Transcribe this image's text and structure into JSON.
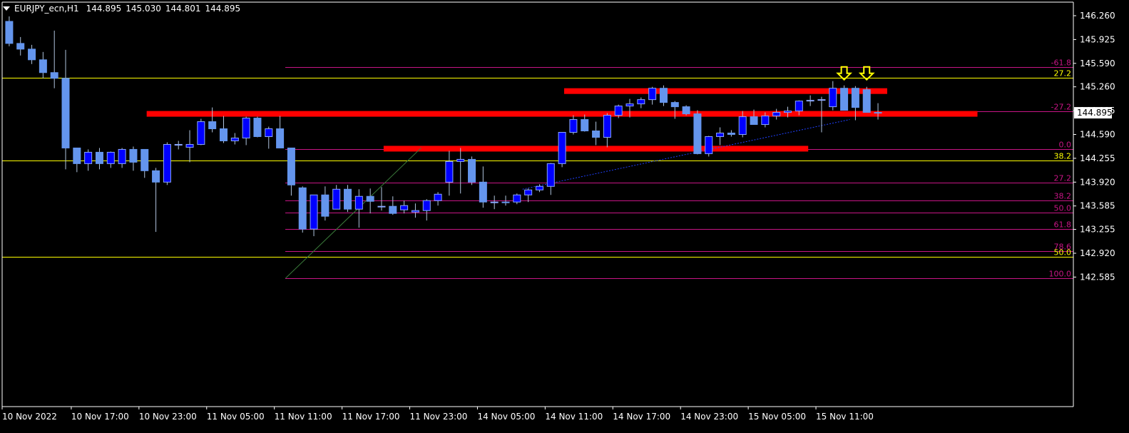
{
  "header": {
    "symbol": "EURJPY_ecn,H1",
    "open": "144.895",
    "high": "145.030",
    "low": "144.801",
    "close": "144.895"
  },
  "colors": {
    "background": "#000000",
    "axis": "#ffffff",
    "bull_candle": "#0000ff",
    "bear_candle": "#6495ed",
    "wick": "#b0c4de",
    "fib_ext_line": "#c71585",
    "fib_ext_label": "#c71585",
    "yellow_level": "#ffff00",
    "red_zone": "#ff0000",
    "trendline": "#2040ff",
    "arrows": "#ffff00",
    "price_label_bg": "#ffffff",
    "price_label_text": "#000000"
  },
  "chart_data": {
    "type": "candlestick",
    "timeframe": "H1",
    "y_ticks": [
      "146.260",
      "145.925",
      "145.590",
      "145.260",
      "144.925",
      "144.590",
      "144.255",
      "143.920",
      "143.585",
      "143.255",
      "142.920",
      "142.585"
    ],
    "x_ticks": [
      "10 Nov 2022",
      "10 Nov 17:00",
      "10 Nov 23:00",
      "11 Nov 05:00",
      "11 Nov 11:00",
      "11 Nov 17:00",
      "11 Nov 23:00",
      "14 Nov 05:00",
      "14 Nov 11:00",
      "14 Nov 17:00",
      "14 Nov 23:00",
      "15 Nov 05:00",
      "15 Nov 11:00"
    ],
    "current_price": "144.895",
    "candles": [
      {
        "o": 146.18,
        "h": 146.25,
        "l": 145.83,
        "c": 145.87
      },
      {
        "o": 145.87,
        "h": 145.96,
        "l": 145.7,
        "c": 145.79
      },
      {
        "o": 145.79,
        "h": 145.85,
        "l": 145.58,
        "c": 145.64
      },
      {
        "o": 145.64,
        "h": 145.75,
        "l": 145.38,
        "c": 145.46
      },
      {
        "o": 145.46,
        "h": 146.05,
        "l": 145.24,
        "c": 145.38
      },
      {
        "o": 145.38,
        "h": 145.78,
        "l": 144.1,
        "c": 144.4
      },
      {
        "o": 144.4,
        "h": 144.4,
        "l": 144.06,
        "c": 144.18
      },
      {
        "o": 144.18,
        "h": 144.38,
        "l": 144.08,
        "c": 144.34
      },
      {
        "o": 144.34,
        "h": 144.4,
        "l": 144.1,
        "c": 144.18
      },
      {
        "o": 144.18,
        "h": 144.35,
        "l": 144.12,
        "c": 144.34
      },
      {
        "o": 144.18,
        "h": 144.4,
        "l": 144.12,
        "c": 144.38
      },
      {
        "o": 144.38,
        "h": 144.42,
        "l": 144.08,
        "c": 144.2
      },
      {
        "o": 144.38,
        "h": 144.38,
        "l": 143.98,
        "c": 144.08
      },
      {
        "o": 144.08,
        "h": 144.12,
        "l": 143.22,
        "c": 143.92
      },
      {
        "o": 143.92,
        "h": 144.48,
        "l": 143.88,
        "c": 144.45
      },
      {
        "o": 144.45,
        "h": 144.5,
        "l": 144.38,
        "c": 144.45
      },
      {
        "o": 144.41,
        "h": 144.65,
        "l": 144.2,
        "c": 144.45
      },
      {
        "o": 144.45,
        "h": 144.81,
        "l": 144.44,
        "c": 144.77
      },
      {
        "o": 144.77,
        "h": 144.97,
        "l": 144.62,
        "c": 144.67
      },
      {
        "o": 144.67,
        "h": 144.85,
        "l": 144.47,
        "c": 144.5
      },
      {
        "o": 144.5,
        "h": 144.61,
        "l": 144.45,
        "c": 144.54
      },
      {
        "o": 144.54,
        "h": 144.84,
        "l": 144.44,
        "c": 144.82
      },
      {
        "o": 144.82,
        "h": 144.84,
        "l": 144.55,
        "c": 144.56
      },
      {
        "o": 144.56,
        "h": 144.7,
        "l": 144.39,
        "c": 144.67
      },
      {
        "o": 144.67,
        "h": 144.85,
        "l": 144.41,
        "c": 144.4
      },
      {
        "o": 144.4,
        "h": 144.4,
        "l": 143.73,
        "c": 143.88
      },
      {
        "o": 143.84,
        "h": 143.86,
        "l": 143.21,
        "c": 143.26
      },
      {
        "o": 143.26,
        "h": 143.74,
        "l": 143.16,
        "c": 143.74
      },
      {
        "o": 143.74,
        "h": 143.86,
        "l": 143.38,
        "c": 143.44
      },
      {
        "o": 143.54,
        "h": 143.88,
        "l": 143.54,
        "c": 143.82
      },
      {
        "o": 143.82,
        "h": 143.88,
        "l": 143.5,
        "c": 143.54
      },
      {
        "o": 143.54,
        "h": 143.82,
        "l": 143.28,
        "c": 143.72
      },
      {
        "o": 143.72,
        "h": 143.83,
        "l": 143.48,
        "c": 143.65
      },
      {
        "o": 143.58,
        "h": 143.85,
        "l": 143.52,
        "c": 143.58
      },
      {
        "o": 143.58,
        "h": 143.72,
        "l": 143.46,
        "c": 143.48
      },
      {
        "o": 143.53,
        "h": 143.66,
        "l": 143.48,
        "c": 143.59
      },
      {
        "o": 143.5,
        "h": 143.62,
        "l": 143.42,
        "c": 143.52
      },
      {
        "o": 143.52,
        "h": 143.68,
        "l": 143.38,
        "c": 143.66
      },
      {
        "o": 143.66,
        "h": 143.78,
        "l": 143.59,
        "c": 143.75
      },
      {
        "o": 143.92,
        "h": 144.36,
        "l": 143.73,
        "c": 144.21
      },
      {
        "o": 144.21,
        "h": 144.4,
        "l": 143.76,
        "c": 144.24
      },
      {
        "o": 144.24,
        "h": 144.28,
        "l": 143.88,
        "c": 143.92
      },
      {
        "o": 143.92,
        "h": 144.14,
        "l": 143.56,
        "c": 143.64
      },
      {
        "o": 143.64,
        "h": 143.73,
        "l": 143.54,
        "c": 143.64
      },
      {
        "o": 143.64,
        "h": 143.73,
        "l": 143.59,
        "c": 143.63
      },
      {
        "o": 143.64,
        "h": 143.76,
        "l": 143.61,
        "c": 143.74
      },
      {
        "o": 143.74,
        "h": 143.83,
        "l": 143.64,
        "c": 143.81
      },
      {
        "o": 143.81,
        "h": 143.89,
        "l": 143.78,
        "c": 143.86
      },
      {
        "o": 143.86,
        "h": 144.19,
        "l": 143.74,
        "c": 144.18
      },
      {
        "o": 144.18,
        "h": 144.62,
        "l": 144.13,
        "c": 144.62
      },
      {
        "o": 144.62,
        "h": 144.86,
        "l": 144.59,
        "c": 144.8
      },
      {
        "o": 144.8,
        "h": 144.87,
        "l": 144.63,
        "c": 144.64
      },
      {
        "o": 144.64,
        "h": 144.77,
        "l": 144.44,
        "c": 144.55
      },
      {
        "o": 144.55,
        "h": 144.89,
        "l": 144.41,
        "c": 144.86
      },
      {
        "o": 144.86,
        "h": 145.01,
        "l": 144.82,
        "c": 144.99
      },
      {
        "o": 144.99,
        "h": 145.09,
        "l": 144.83,
        "c": 145.02
      },
      {
        "o": 145.02,
        "h": 145.11,
        "l": 144.96,
        "c": 145.08
      },
      {
        "o": 145.08,
        "h": 145.26,
        "l": 145.01,
        "c": 145.24
      },
      {
        "o": 145.24,
        "h": 145.28,
        "l": 144.99,
        "c": 145.04
      },
      {
        "o": 145.04,
        "h": 145.06,
        "l": 144.81,
        "c": 144.98
      },
      {
        "o": 144.98,
        "h": 145.0,
        "l": 144.86,
        "c": 144.88
      },
      {
        "o": 144.88,
        "h": 144.93,
        "l": 144.31,
        "c": 144.32
      },
      {
        "o": 144.32,
        "h": 144.57,
        "l": 144.28,
        "c": 144.56
      },
      {
        "o": 144.56,
        "h": 144.69,
        "l": 144.44,
        "c": 144.61
      },
      {
        "o": 144.61,
        "h": 144.65,
        "l": 144.56,
        "c": 144.59
      },
      {
        "o": 144.59,
        "h": 144.92,
        "l": 144.55,
        "c": 144.84
      },
      {
        "o": 144.84,
        "h": 144.94,
        "l": 144.76,
        "c": 144.73
      },
      {
        "o": 144.73,
        "h": 144.9,
        "l": 144.69,
        "c": 144.85
      },
      {
        "o": 144.85,
        "h": 144.95,
        "l": 144.8,
        "c": 144.9
      },
      {
        "o": 144.9,
        "h": 144.98,
        "l": 144.83,
        "c": 144.92
      },
      {
        "o": 144.92,
        "h": 145.07,
        "l": 144.86,
        "c": 145.06
      },
      {
        "o": 145.06,
        "h": 145.14,
        "l": 144.99,
        "c": 145.07
      },
      {
        "o": 145.07,
        "h": 145.12,
        "l": 144.62,
        "c": 145.08
      },
      {
        "o": 144.98,
        "h": 145.34,
        "l": 144.93,
        "c": 145.24
      },
      {
        "o": 145.24,
        "h": 145.28,
        "l": 144.95,
        "c": 144.93
      },
      {
        "o": 145.24,
        "h": 145.27,
        "l": 144.79,
        "c": 144.97
      },
      {
        "o": 145.22,
        "h": 145.26,
        "l": 144.9,
        "c": 144.9
      },
      {
        "o": 144.9,
        "h": 145.03,
        "l": 144.8,
        "c": 144.895
      }
    ],
    "horizontal_levels": [
      {
        "price": 145.54,
        "label": "-61.8",
        "color": "#c71585"
      },
      {
        "price": 145.385,
        "label": "27.2",
        "color": "#ffff00"
      },
      {
        "price": 144.915,
        "label": "-27.2",
        "color": "#c71585"
      },
      {
        "price": 144.38,
        "label": "0.0",
        "color": "#c71585"
      },
      {
        "price": 144.22,
        "label": "38.2",
        "color": "#ffff00"
      },
      {
        "price": 143.91,
        "label": "27.2",
        "color": "#c71585"
      },
      {
        "price": 143.66,
        "label": "38.2",
        "color": "#c71585"
      },
      {
        "price": 143.49,
        "label": "50.0",
        "color": "#c71585"
      },
      {
        "price": 143.26,
        "label": "61.8",
        "color": "#c71585"
      },
      {
        "price": 142.95,
        "label": "78.6",
        "color": "#c71585"
      },
      {
        "price": 142.87,
        "label": "50.0",
        "color": "#ffff00"
      },
      {
        "price": 142.57,
        "label": "100.0",
        "color": "#c71585"
      }
    ],
    "zones": [
      {
        "price": 145.2,
        "from_bar": 50,
        "to_bar": 78
      },
      {
        "price": 144.88,
        "from_bar": 13,
        "to_bar": 86
      },
      {
        "price": 144.39,
        "from_bar": 34,
        "to_bar": 71
      }
    ],
    "arrows": [
      {
        "bar": 74,
        "direction": "down"
      },
      {
        "bar": 76,
        "direction": "down"
      }
    ]
  }
}
